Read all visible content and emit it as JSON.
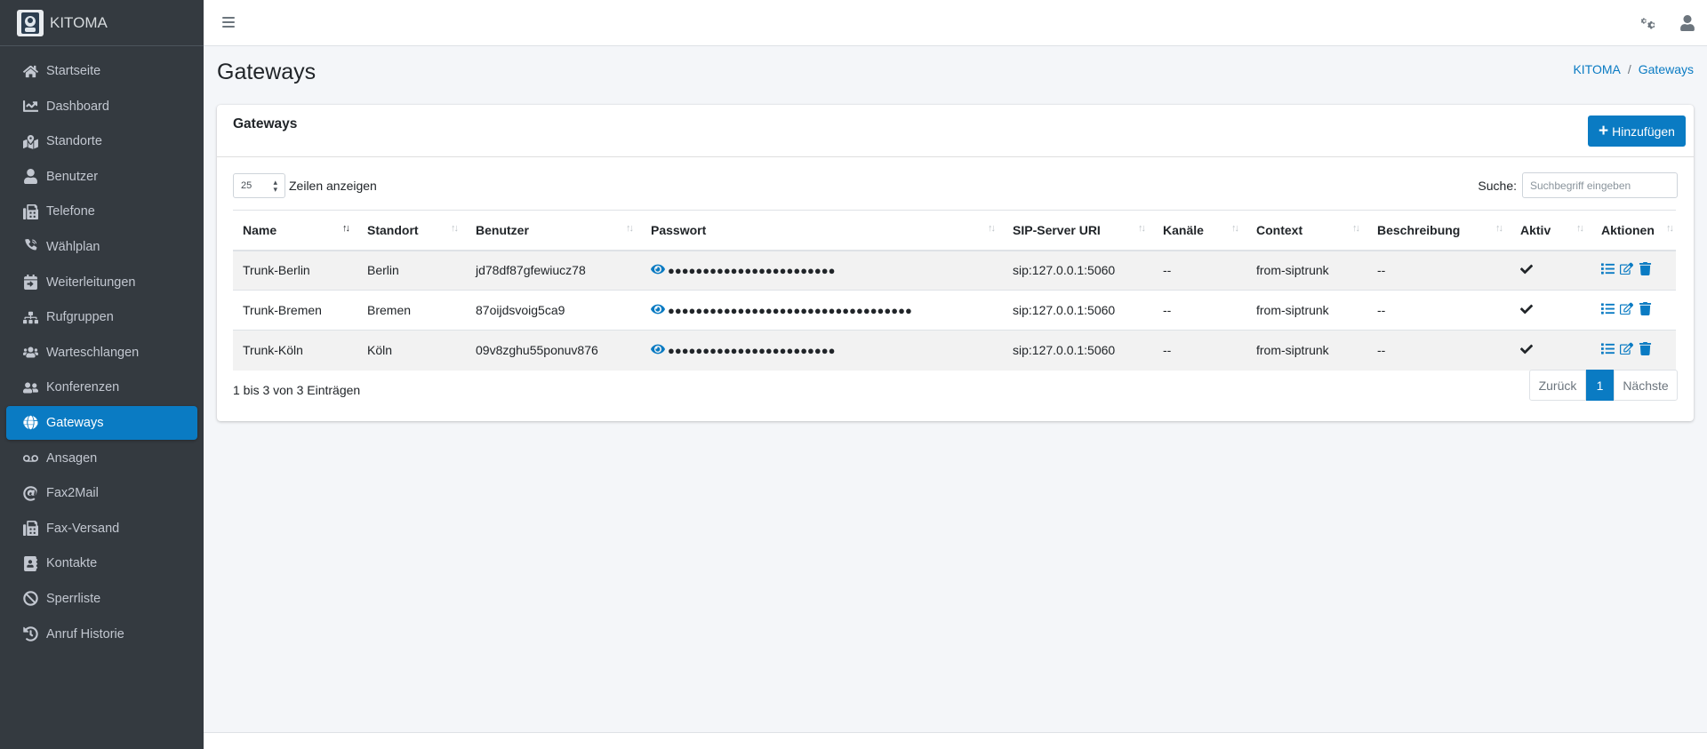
{
  "brand": {
    "name": "KITOMA"
  },
  "sidebar": {
    "items": [
      {
        "label": "Startseite",
        "icon": "home-icon"
      },
      {
        "label": "Dashboard",
        "icon": "chart-line-icon"
      },
      {
        "label": "Standorte",
        "icon": "map-marked-icon"
      },
      {
        "label": "Benutzer",
        "icon": "user-icon"
      },
      {
        "label": "Telefone",
        "icon": "fax-icon"
      },
      {
        "label": "Wählplan",
        "icon": "phone-volume-icon"
      },
      {
        "label": "Weiterleitungen",
        "icon": "calendar-forward-icon"
      },
      {
        "label": "Rufgruppen",
        "icon": "sitemap-icon"
      },
      {
        "label": "Warteschlangen",
        "icon": "users-icon"
      },
      {
        "label": "Konferenzen",
        "icon": "user-friends-icon"
      },
      {
        "label": "Gateways",
        "icon": "globe-icon",
        "active": true
      },
      {
        "label": "Ansagen",
        "icon": "voicemail-icon"
      },
      {
        "label": "Fax2Mail",
        "icon": "at-icon"
      },
      {
        "label": "Fax-Versand",
        "icon": "fax-icon"
      },
      {
        "label": "Kontakte",
        "icon": "address-book-icon"
      },
      {
        "label": "Sperrliste",
        "icon": "ban-icon"
      },
      {
        "label": "Anruf Historie",
        "icon": "history-icon"
      }
    ]
  },
  "header": {
    "icons": [
      "cogs-icon",
      "user-icon"
    ]
  },
  "page": {
    "title": "Gateways"
  },
  "breadcrumb": {
    "home": "KITOMA",
    "separator": "/",
    "current": "Gateways"
  },
  "card": {
    "title": "Gateways",
    "add_button": "Hinzufügen",
    "length_value": "25",
    "length_label": "Zeilen anzeigen",
    "search_label": "Suche:",
    "search_placeholder": "Suchbegriff eingeben"
  },
  "table": {
    "columns": [
      "Name",
      "Standort",
      "Benutzer",
      "Passwort",
      "SIP-Server URI",
      "Kanäle",
      "Context",
      "Beschreibung",
      "Aktiv",
      "Aktionen"
    ],
    "rows": [
      {
        "name": "Trunk-Berlin",
        "standort": "Berlin",
        "benutzer": "jd78df87gfewiucz78",
        "passwort": "●●●●●●●●●●●●●●●●●●●●●●●●",
        "sip": "sip:127.0.0.1:5060",
        "kanaele": "--",
        "context": "from-siptrunk",
        "beschreibung": "--"
      },
      {
        "name": "Trunk-Bremen",
        "standort": "Bremen",
        "benutzer": "87oijdsvoig5ca9",
        "passwort": "●●●●●●●●●●●●●●●●●●●●●●●●●●●●●●●●●●●",
        "sip": "sip:127.0.0.1:5060",
        "kanaele": "--",
        "context": "from-siptrunk",
        "beschreibung": "--"
      },
      {
        "name": "Trunk-Köln",
        "standort": "Köln",
        "benutzer": "09v8zghu55ponuv876",
        "passwort": "●●●●●●●●●●●●●●●●●●●●●●●●",
        "sip": "sip:127.0.0.1:5060",
        "kanaele": "--",
        "context": "from-siptrunk",
        "beschreibung": "--"
      }
    ]
  },
  "footer_info": "1 bis 3 von 3 Einträgen",
  "pagination": {
    "prev": "Zurück",
    "current": "1",
    "next": "Nächste"
  },
  "colors": {
    "sidebar_bg": "#343a40",
    "accent": "#0a7bc3",
    "body_bg": "#f4f6f9"
  }
}
